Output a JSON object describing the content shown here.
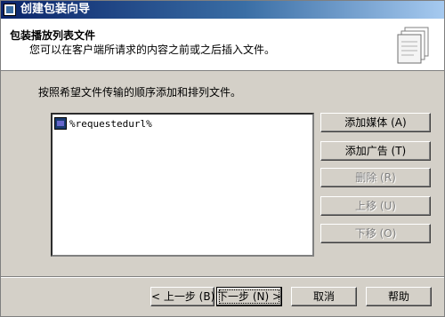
{
  "window": {
    "title": "创建包装向导"
  },
  "header": {
    "title": "包装播放列表文件",
    "subtitle": "您可以在客户端所请求的内容之前或之后插入文件。"
  },
  "main": {
    "instruction": "按照希望文件传输的顺序添加和排列文件。",
    "file_list": [
      {
        "name": "%requestedurl%"
      }
    ]
  },
  "side_buttons": {
    "add_media": "添加媒体 (A)",
    "add_ad": "添加广告 (T)",
    "delete": "删除 (R)",
    "move_up": "上移 (U)",
    "move_down": "下移 (O)"
  },
  "footer": {
    "back": "< 上一步 (B)",
    "next": "下一步 (N) >",
    "cancel": "取消",
    "help": "帮助"
  },
  "icons": {
    "title_icon": "wizard-window-icon",
    "header_icon": "documents-stack-icon",
    "file_icon": "media-file-icon"
  }
}
